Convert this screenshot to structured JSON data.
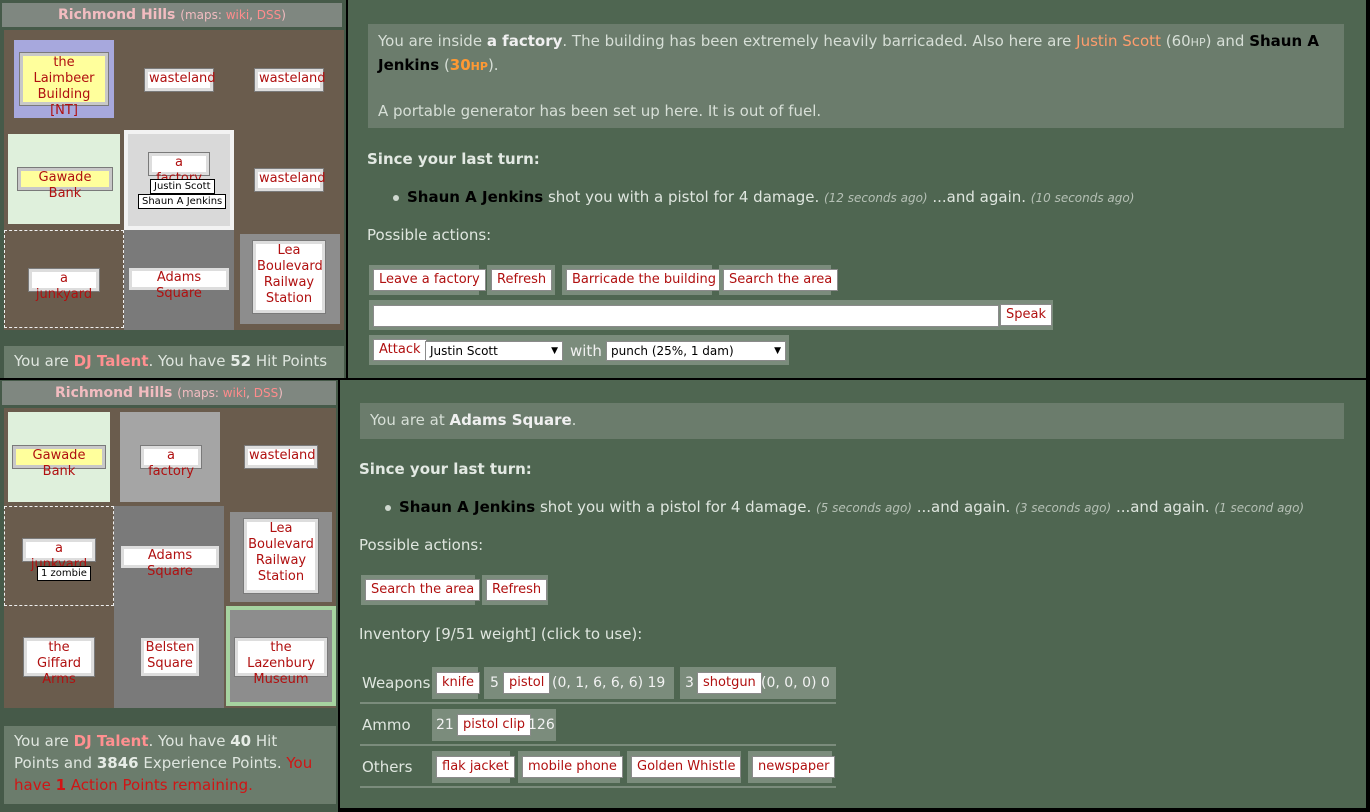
{
  "top": {
    "suburb": "Richmond Hills",
    "maps_prefix": "(maps: ",
    "maps_wiki": "wiki",
    "maps_sep": ", ",
    "maps_dss": "DSS",
    "maps_suffix": ")",
    "grid": {
      "nw": "the Laimbeer Building [NT]",
      "n": "wasteland",
      "ne": "wasteland",
      "w": "Gawade Bank",
      "c": "a factory",
      "c_occupant1": "Justin Scott",
      "c_occupant2": "Shaun A Jenkins",
      "e": "wasteland",
      "sw": "a junkyard",
      "s": "Adams Square",
      "se": "Lea Boulevard Railway Station"
    },
    "status": {
      "pre": "You are ",
      "name": "DJ Talent",
      "mid": ". You have ",
      "hp": "52",
      "post": " Hit Points"
    },
    "desc": {
      "p1_a": "You are inside ",
      "p1_place": "a factory",
      "p1_b": ". The building has been extremely heavily barricaded. Also here are ",
      "p1_person1": "Justin Scott",
      "p1_hp1": " (60",
      "p1_hp1_unit": "HP",
      "p1_c": ") and ",
      "p1_person2": "Shaun A Jenkins",
      "p1_d": " (",
      "p1_hp2": "30",
      "p1_hp2_unit": "HP",
      "p1_e": ").",
      "p2": "A portable generator has been set up here. It is out of fuel."
    },
    "since_heading": "Since your last turn:",
    "event": {
      "actor": "Shaun A Jenkins",
      "text": " shot you with a pistol for 4 damage. ",
      "ago1": "(12 seconds ago)",
      "again": " ...and again. ",
      "ago2": "(10 seconds ago)"
    },
    "actions_heading": "Possible actions:",
    "actions": {
      "leave": "Leave a factory",
      "refresh": "Refresh",
      "barricade": "Barricade the building",
      "search": "Search the area",
      "speak": "Speak",
      "attack": "Attack",
      "target": "Justin Scott",
      "with": "with",
      "weapon": "punch (25%, 1 dam)"
    }
  },
  "bottom": {
    "suburb": "Richmond Hills",
    "maps_prefix": "(maps: ",
    "maps_wiki": "wiki",
    "maps_sep": ", ",
    "maps_dss": "DSS",
    "maps_suffix": ")",
    "grid": {
      "nw": "Gawade Bank",
      "n": "a factory",
      "ne": "wasteland",
      "w": "a junkyard",
      "w_occupant": "1 zombie",
      "c": "Adams Square",
      "e": "Lea Boulevard Railway Station",
      "sw": "the Giffard Arms",
      "s": "Belsten Square",
      "se": "the Lazenbury Museum"
    },
    "status": {
      "pre": "You are ",
      "name": "DJ Talent",
      "mid": ". You have ",
      "hp": "40",
      "mid2": " Hit Points and ",
      "xp": "3846",
      "mid3": " Experience Points. ",
      "ap_pre": "You have ",
      "ap": "1",
      "ap_post": " Action Points remaining."
    },
    "desc": {
      "a": "You are at ",
      "place": "Adams Square",
      "b": "."
    },
    "since_heading": "Since your last turn:",
    "event": {
      "actor": "Shaun A Jenkins",
      "text": " shot you with a pistol for 4 damage. ",
      "ago1": "(5 seconds ago)",
      "again1": " ...and again. ",
      "ago2": "(3 seconds ago)",
      "again2": " ...and again. ",
      "ago3": "(1 second ago)"
    },
    "actions_heading": "Possible actions:",
    "actions": {
      "search": "Search the area",
      "refresh": "Refresh"
    },
    "inventory_heading": "Inventory [9/51 weight] (click to use):",
    "inventory": {
      "weapons_label": "Weapons",
      "knife": "knife",
      "pistol_count": "5",
      "pistol": "pistol",
      "pistol_ammo": "(0, 1, 6, 6, 6) 19",
      "shotgun_count": "3",
      "shotgun": "shotgun",
      "shotgun_ammo": "(0, 0, 0) 0",
      "ammo_label": "Ammo",
      "clip_count": "21",
      "clip": "pistol clip",
      "clip_total": "126",
      "others_label": "Others",
      "flak": "flak jacket",
      "phone": "mobile phone",
      "whistle": "Golden Whistle",
      "newspaper": "newspaper"
    }
  }
}
